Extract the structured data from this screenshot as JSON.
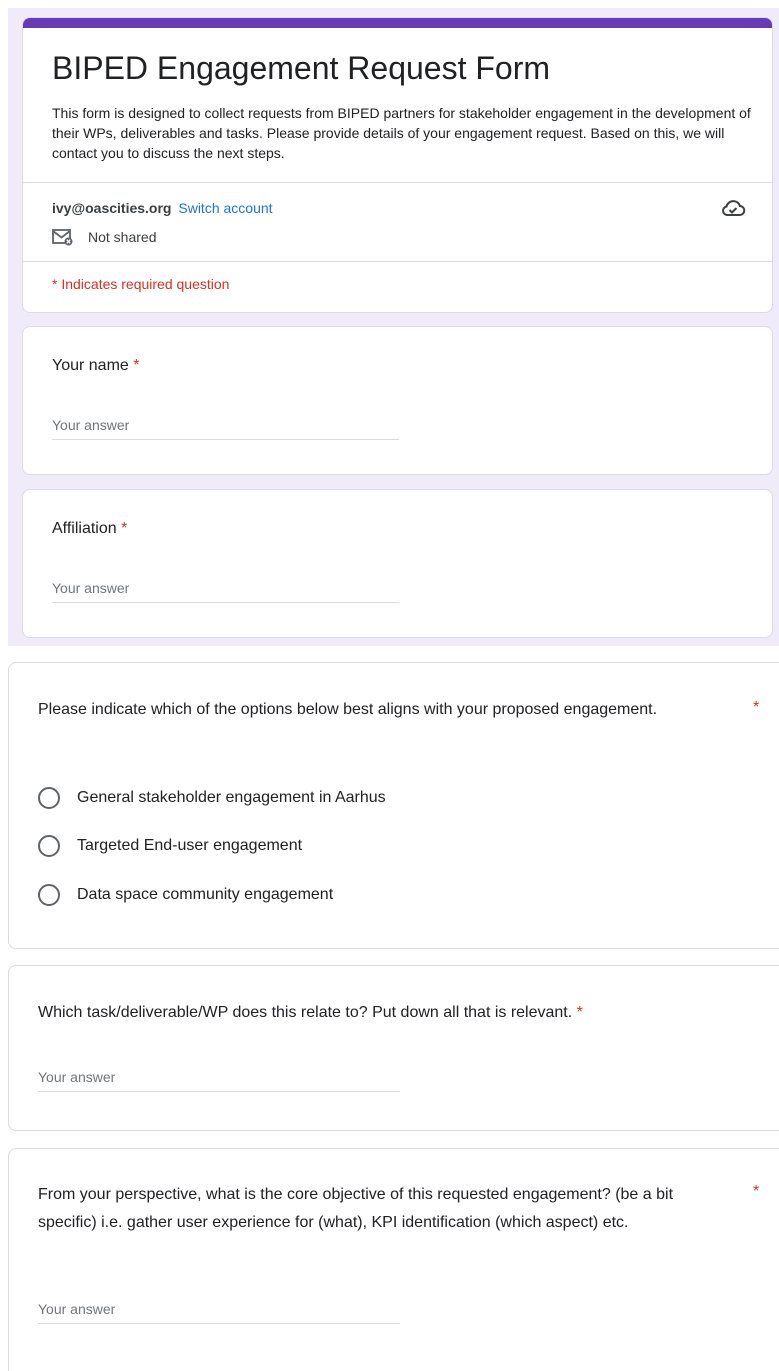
{
  "form": {
    "title": "BIPED Engagement Request Form",
    "description": "This form is designed to collect requests from BIPED partners for stakeholder engagement in the development of their WPs, deliverables and tasks. Please provide details of your engagement request. Based on this, we will contact you to discuss the next steps.",
    "account_email": "ivy@oascities.org",
    "switch_account_label": "Switch account",
    "not_shared_label": "Not shared",
    "required_note": "* Indicates required question",
    "accent_color": "#673ab7",
    "required_color": "#d93025",
    "link_color": "#1a73e8"
  },
  "questions": {
    "name": {
      "label": "Your name",
      "required_mark": "*",
      "placeholder": "Your answer"
    },
    "affiliation": {
      "label": "Affiliation",
      "required_mark": "*",
      "placeholder": "Your answer"
    },
    "engagement_type": {
      "label": "Please indicate which of the options below best aligns with your proposed engagement.",
      "required_mark": "*",
      "options": [
        "General stakeholder engagement in Aarhus",
        "Targeted End-user engagement",
        "Data space community engagement"
      ]
    },
    "task_relation": {
      "label": "Which task/deliverable/WP does this relate to? Put down all that is relevant.",
      "required_mark": "*",
      "placeholder": "Your answer"
    },
    "core_objective": {
      "label": "From your perspective, what is the core objective of this requested engagement? (be a bit specific) i.e. gather user experience for (what), KPI identification (which aspect) etc.",
      "required_mark": "*",
      "placeholder": "Your answer"
    }
  },
  "icons": {
    "cloud": "cloud-check-icon",
    "mail": "mail-off-icon",
    "radio": "radio-unchecked-icon"
  }
}
